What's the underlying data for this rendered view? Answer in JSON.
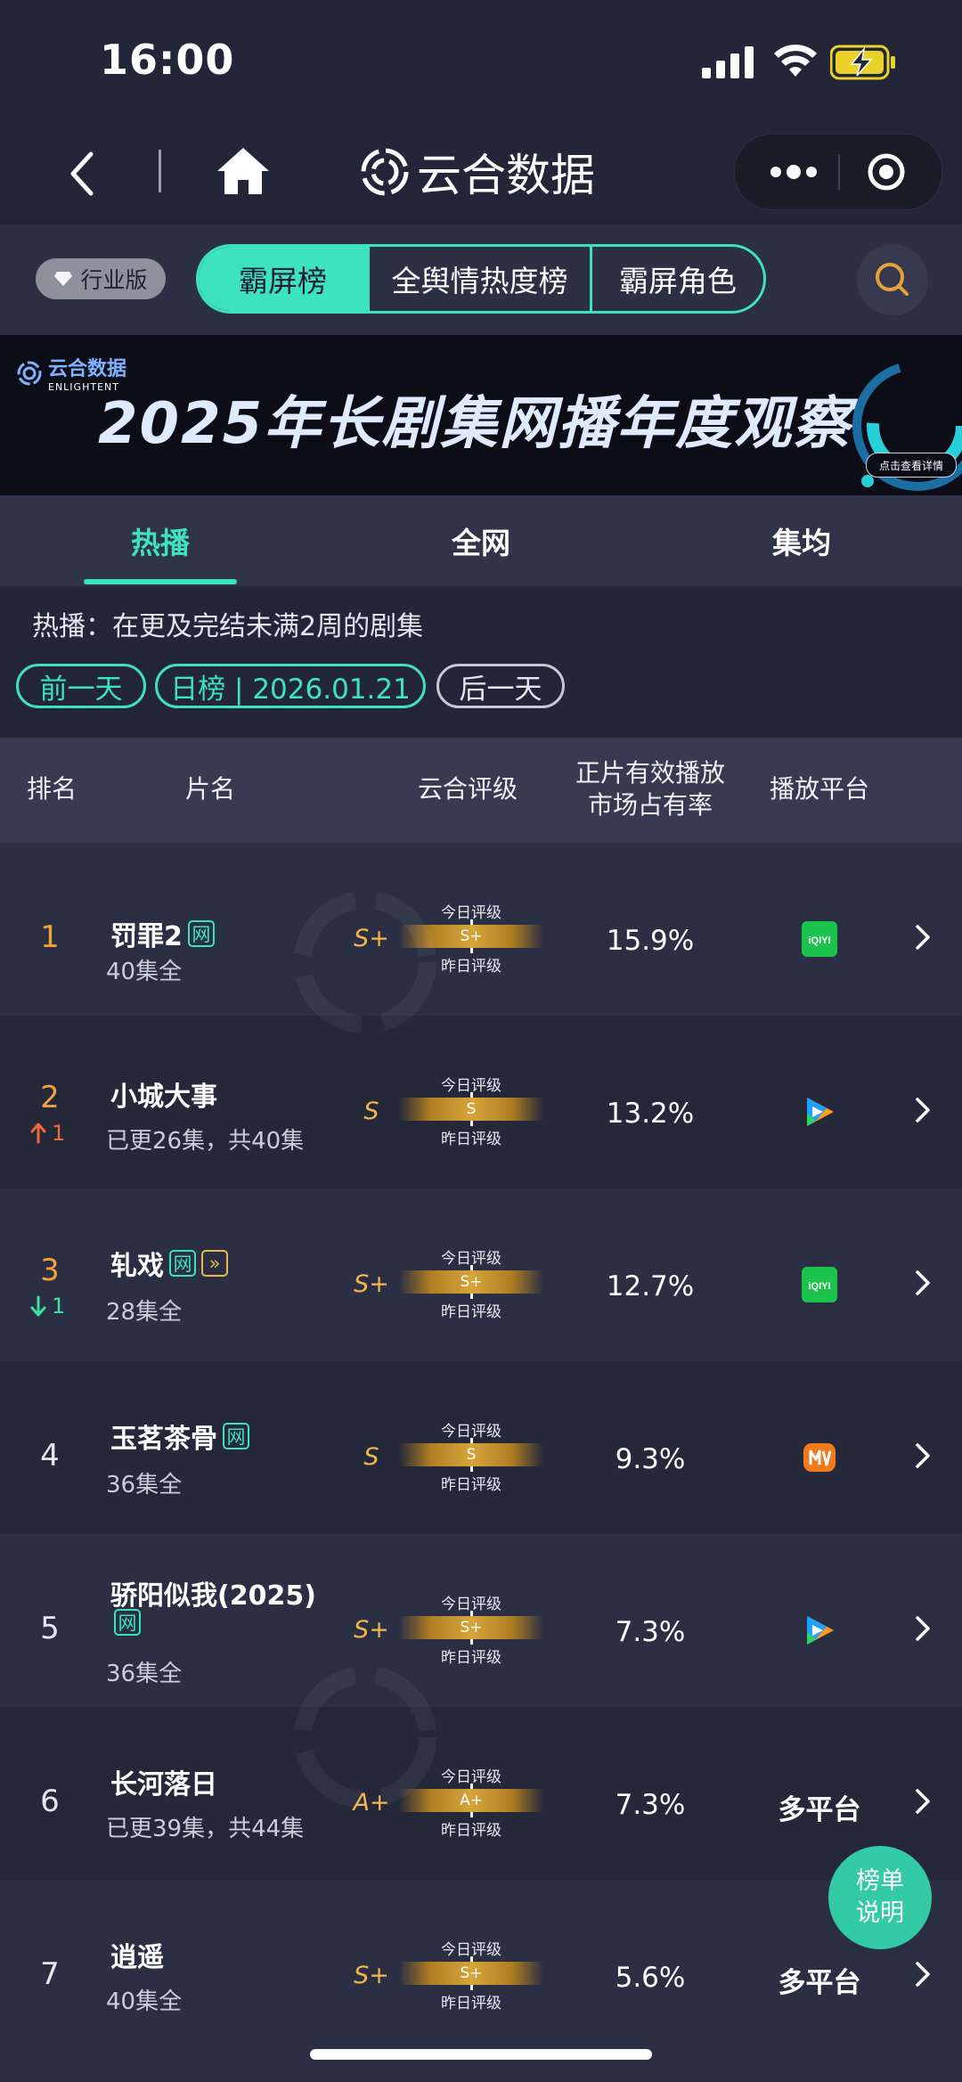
{
  "status_bar": {
    "time": "16:00"
  },
  "navbar": {
    "brand_title": "云合数据"
  },
  "top_tabs": {
    "industry_badge": "行业版",
    "segments": [
      "霸屏榜",
      "全舆情热度榜",
      "霸屏角色"
    ],
    "active": "霸屏榜"
  },
  "banner": {
    "logo_cn": "云合数据",
    "logo_en": "ENLIGHTENT",
    "title": "2025年长剧集网播年度观察",
    "cta": "点击查看详情"
  },
  "sub_tabs": {
    "items": [
      "热播",
      "全网",
      "集均"
    ],
    "active": "热播"
  },
  "description": "热播：在更及完结未满2周的剧集",
  "date_nav": {
    "prev": "前一天",
    "current": "日榜 | 2026.01.21",
    "next": "后一天"
  },
  "table": {
    "headers": {
      "rank": "排名",
      "title": "片名",
      "rating": "云合评级",
      "share_line1": "正片有效播放",
      "share_line2": "市场占有率",
      "platform": "播放平台"
    },
    "gauge_labels": {
      "today": "今日评级",
      "yesterday": "昨日评级"
    },
    "rows": [
      {
        "rank": "1",
        "title": "罚罪2",
        "tags": [
          "网"
        ],
        "episodes": "40集全",
        "grade": "S+",
        "today_grade": "S+",
        "share": "15.9%",
        "platform_icon": "iqiyi-icon",
        "platform_text": "iQIYI"
      },
      {
        "rank": "2",
        "move": "1",
        "move_dir": "up",
        "title": "小城大事",
        "tags": [],
        "episodes": "已更26集，共40集",
        "grade": "S",
        "today_grade": "S",
        "share": "13.2%",
        "platform_icon": "tencent-video-icon"
      },
      {
        "rank": "3",
        "move": "1",
        "move_dir": "down",
        "title": "轧戏",
        "tags": [
          "网",
          "»"
        ],
        "episodes": "28集全",
        "grade": "S+",
        "today_grade": "S+",
        "share": "12.7%",
        "platform_icon": "iqiyi-icon",
        "platform_text": "iQIYI"
      },
      {
        "rank": "4",
        "title": "玉茗茶骨",
        "tags": [
          "网"
        ],
        "episodes": "36集全",
        "grade": "S",
        "today_grade": "S",
        "share": "9.3%",
        "platform_icon": "mango-tv-icon"
      },
      {
        "rank": "5",
        "title": "骄阳似我(2025)",
        "tags": [
          "网"
        ],
        "episodes": "36集全",
        "grade": "S+",
        "today_grade": "S+",
        "share": "7.3%",
        "platform_icon": "tencent-video-icon"
      },
      {
        "rank": "6",
        "title": "长河落日",
        "tags": [],
        "episodes": "已更39集，共44集",
        "grade": "A+",
        "today_grade": "A+",
        "share": "7.3%",
        "platform_text_label": "多平台"
      },
      {
        "rank": "7",
        "title": "逍遥",
        "tags": [],
        "episodes": "40集全",
        "grade": "S+",
        "today_grade": "S+",
        "share": "5.6%",
        "platform_text_label": "多平台"
      }
    ]
  },
  "fab": {
    "line1": "榜单",
    "line2": "说明"
  },
  "colors": {
    "accent": "#3de2c1",
    "gold": "#f2b64c",
    "rank_top": "#f2a03c",
    "up": "#f06a3c",
    "down": "#3de2a0",
    "bg": "#232638"
  }
}
